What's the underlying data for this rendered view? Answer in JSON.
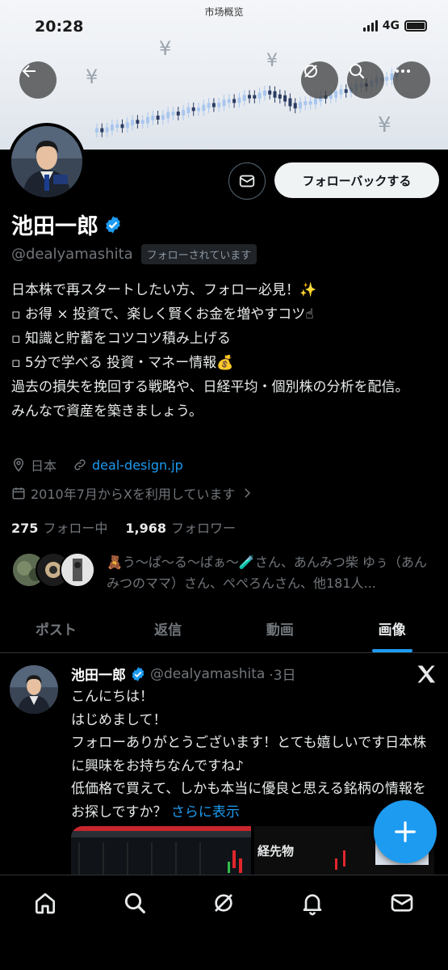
{
  "status_bar": {
    "time": "20:28",
    "title": "市场概览",
    "network": "4G"
  },
  "colors": {
    "accent": "#1d9bf0",
    "background": "#000000",
    "muted": "#71767b",
    "candle_up": "#a9c6ee",
    "candle_down": "#2b3c63"
  },
  "header": {
    "back_icon": "back-arrow-icon",
    "grok_icon": "grok-icon",
    "search_icon": "search-icon",
    "more_icon": "more-icon"
  },
  "banner": {
    "yen_symbols": [
      "¥",
      "¥",
      "¥",
      "¥"
    ]
  },
  "profile": {
    "name": "池田一郎",
    "handle": "@dealyamashita",
    "follows_you": "フォローされています",
    "follow_back_label": "フォローバックする",
    "bio": "日本株で再スタートしたい方、フォロー必見！✨\n▫ お得 × 投資で、楽しく賢くお金を増やすコツ☝\n▫ 知識と貯蓄をコツコツ積み上げる\n▫ 5分で学べる 投資・マネー情報💰\n過去の損失を挽回する戦略や、日経平均・個別株の分析を配信。\nみんなで資産を築きましょう。",
    "location": "日本",
    "website": "deal-design.jp",
    "joined": "2010年7月からXを利用しています",
    "following_count": "275",
    "following_label": "フォロー中",
    "followers_count": "1,968",
    "followers_label": "フォロワー",
    "followed_by_text": "🧸う〜ぱ〜る〜ぱぁ〜🧪さん、あんみつ柴 ゆぅ（あんみつのママ）さん、ぺぺろんさん、他181人..."
  },
  "tabs": [
    {
      "label": "ポスト",
      "active": false
    },
    {
      "label": "返信",
      "active": false
    },
    {
      "label": "動画",
      "active": false
    },
    {
      "label": "画像",
      "active": true
    }
  ],
  "post": {
    "author": "池田一郎",
    "handle": "@dealyamashita",
    "time": "·3日",
    "body": "こんにちは！\nはじめまして！\nフォローありがとうございます！とても嬉しいです日本株に興味をお持ちなんですね♪\n低価格で買えて、しかも本当に優良と思える銘柄の情報をお探しですか？",
    "more_label": "さらに表示",
    "media_text": "経先物"
  },
  "nav": [
    "home-icon",
    "search-icon",
    "grok-icon",
    "notifications-icon",
    "messages-icon"
  ]
}
